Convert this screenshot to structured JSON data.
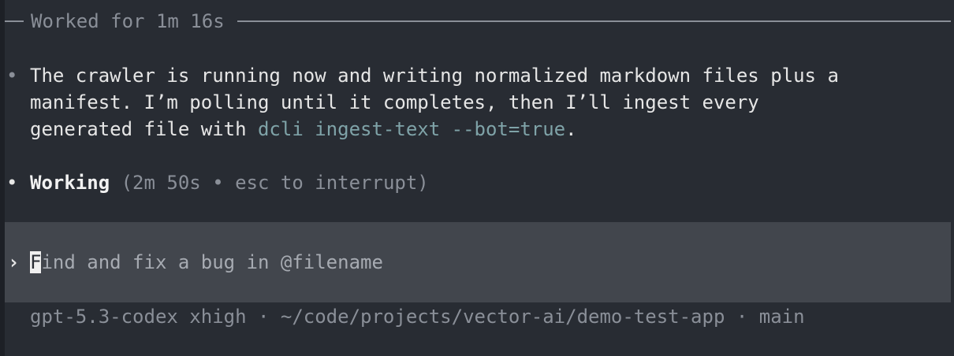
{
  "header": {
    "worked_label": "Worked for 1m 16s"
  },
  "message": {
    "bullet": "•",
    "line1": "The crawler is running now and writing normalized markdown files plus a",
    "line2": "manifest. I’m polling until it completes, then I’ll ingest every",
    "line3_prefix": "generated file with ",
    "command": "dcli ingest-text --bot=true",
    "line3_suffix": "."
  },
  "status": {
    "bullet": "•",
    "label": "Working",
    "detail": " (2m 50s • esc to interrupt)"
  },
  "prompt": {
    "chevron": "›",
    "cursor_char": "F",
    "placeholder_rest": "ind and fix a bug in @filename"
  },
  "footer": {
    "info": "gpt-5.3-codex xhigh · ~/code/projects/vector-ai/demo-test-app · main"
  },
  "colors": {
    "background": "#282c33",
    "prompt_background": "#42464d",
    "dim_text": "#8a8f98",
    "code_text": "#7fa3a8"
  }
}
